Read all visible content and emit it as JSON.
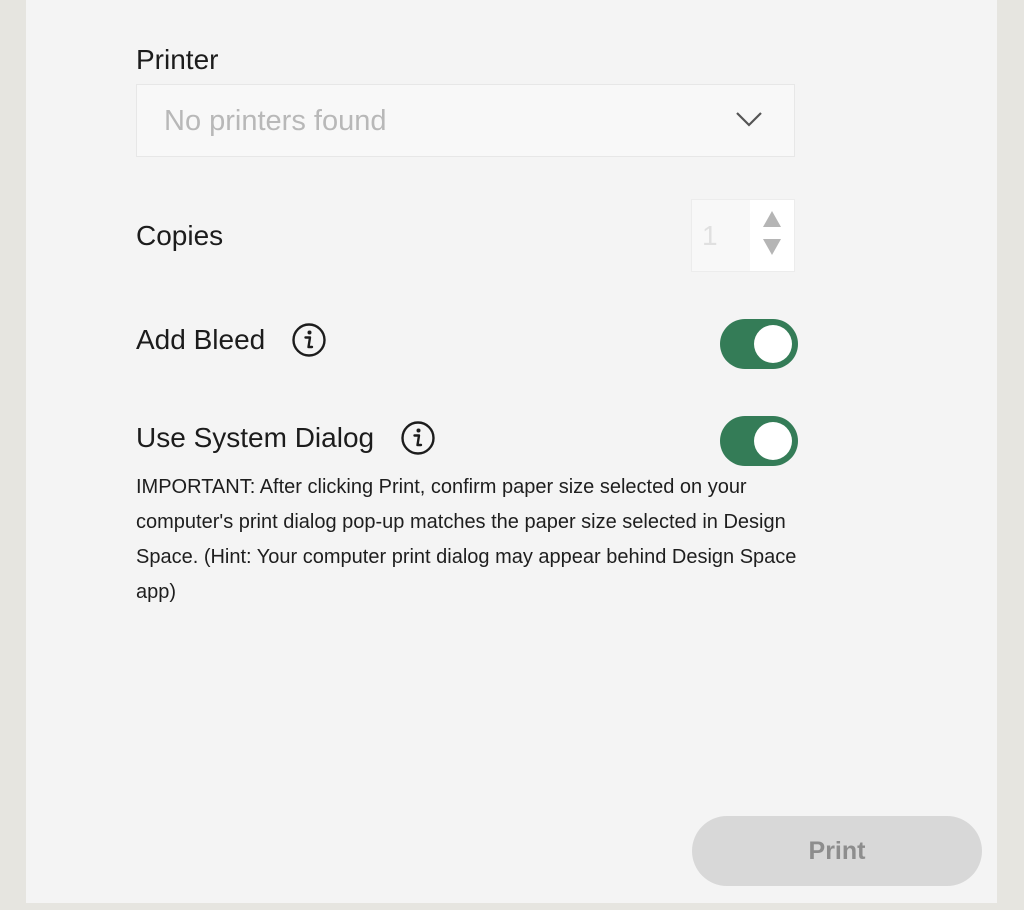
{
  "printer": {
    "label": "Printer",
    "select_value": "No printers found"
  },
  "copies": {
    "label": "Copies",
    "value": "1"
  },
  "add_bleed": {
    "label": "Add Bleed",
    "enabled": true
  },
  "system_dialog": {
    "label": "Use System Dialog",
    "enabled": true,
    "note": "IMPORTANT: After clicking Print, confirm paper size selected on your computer's print dialog pop-up matches the paper size selected in Design Space. (Hint: Your computer print dialog may appear behind Design Space app)"
  },
  "actions": {
    "print_label": "Print"
  },
  "colors": {
    "toggle_on": "#347c57",
    "panel_bg": "#f4f4f4",
    "outer_bg": "#e6e5e0",
    "print_button_disabled": "#d8d8d8"
  },
  "icons": {
    "select_chevron": "chevron-down-icon",
    "info": "info-icon",
    "step_up": "triangle-up-icon",
    "step_down": "triangle-down-icon"
  }
}
